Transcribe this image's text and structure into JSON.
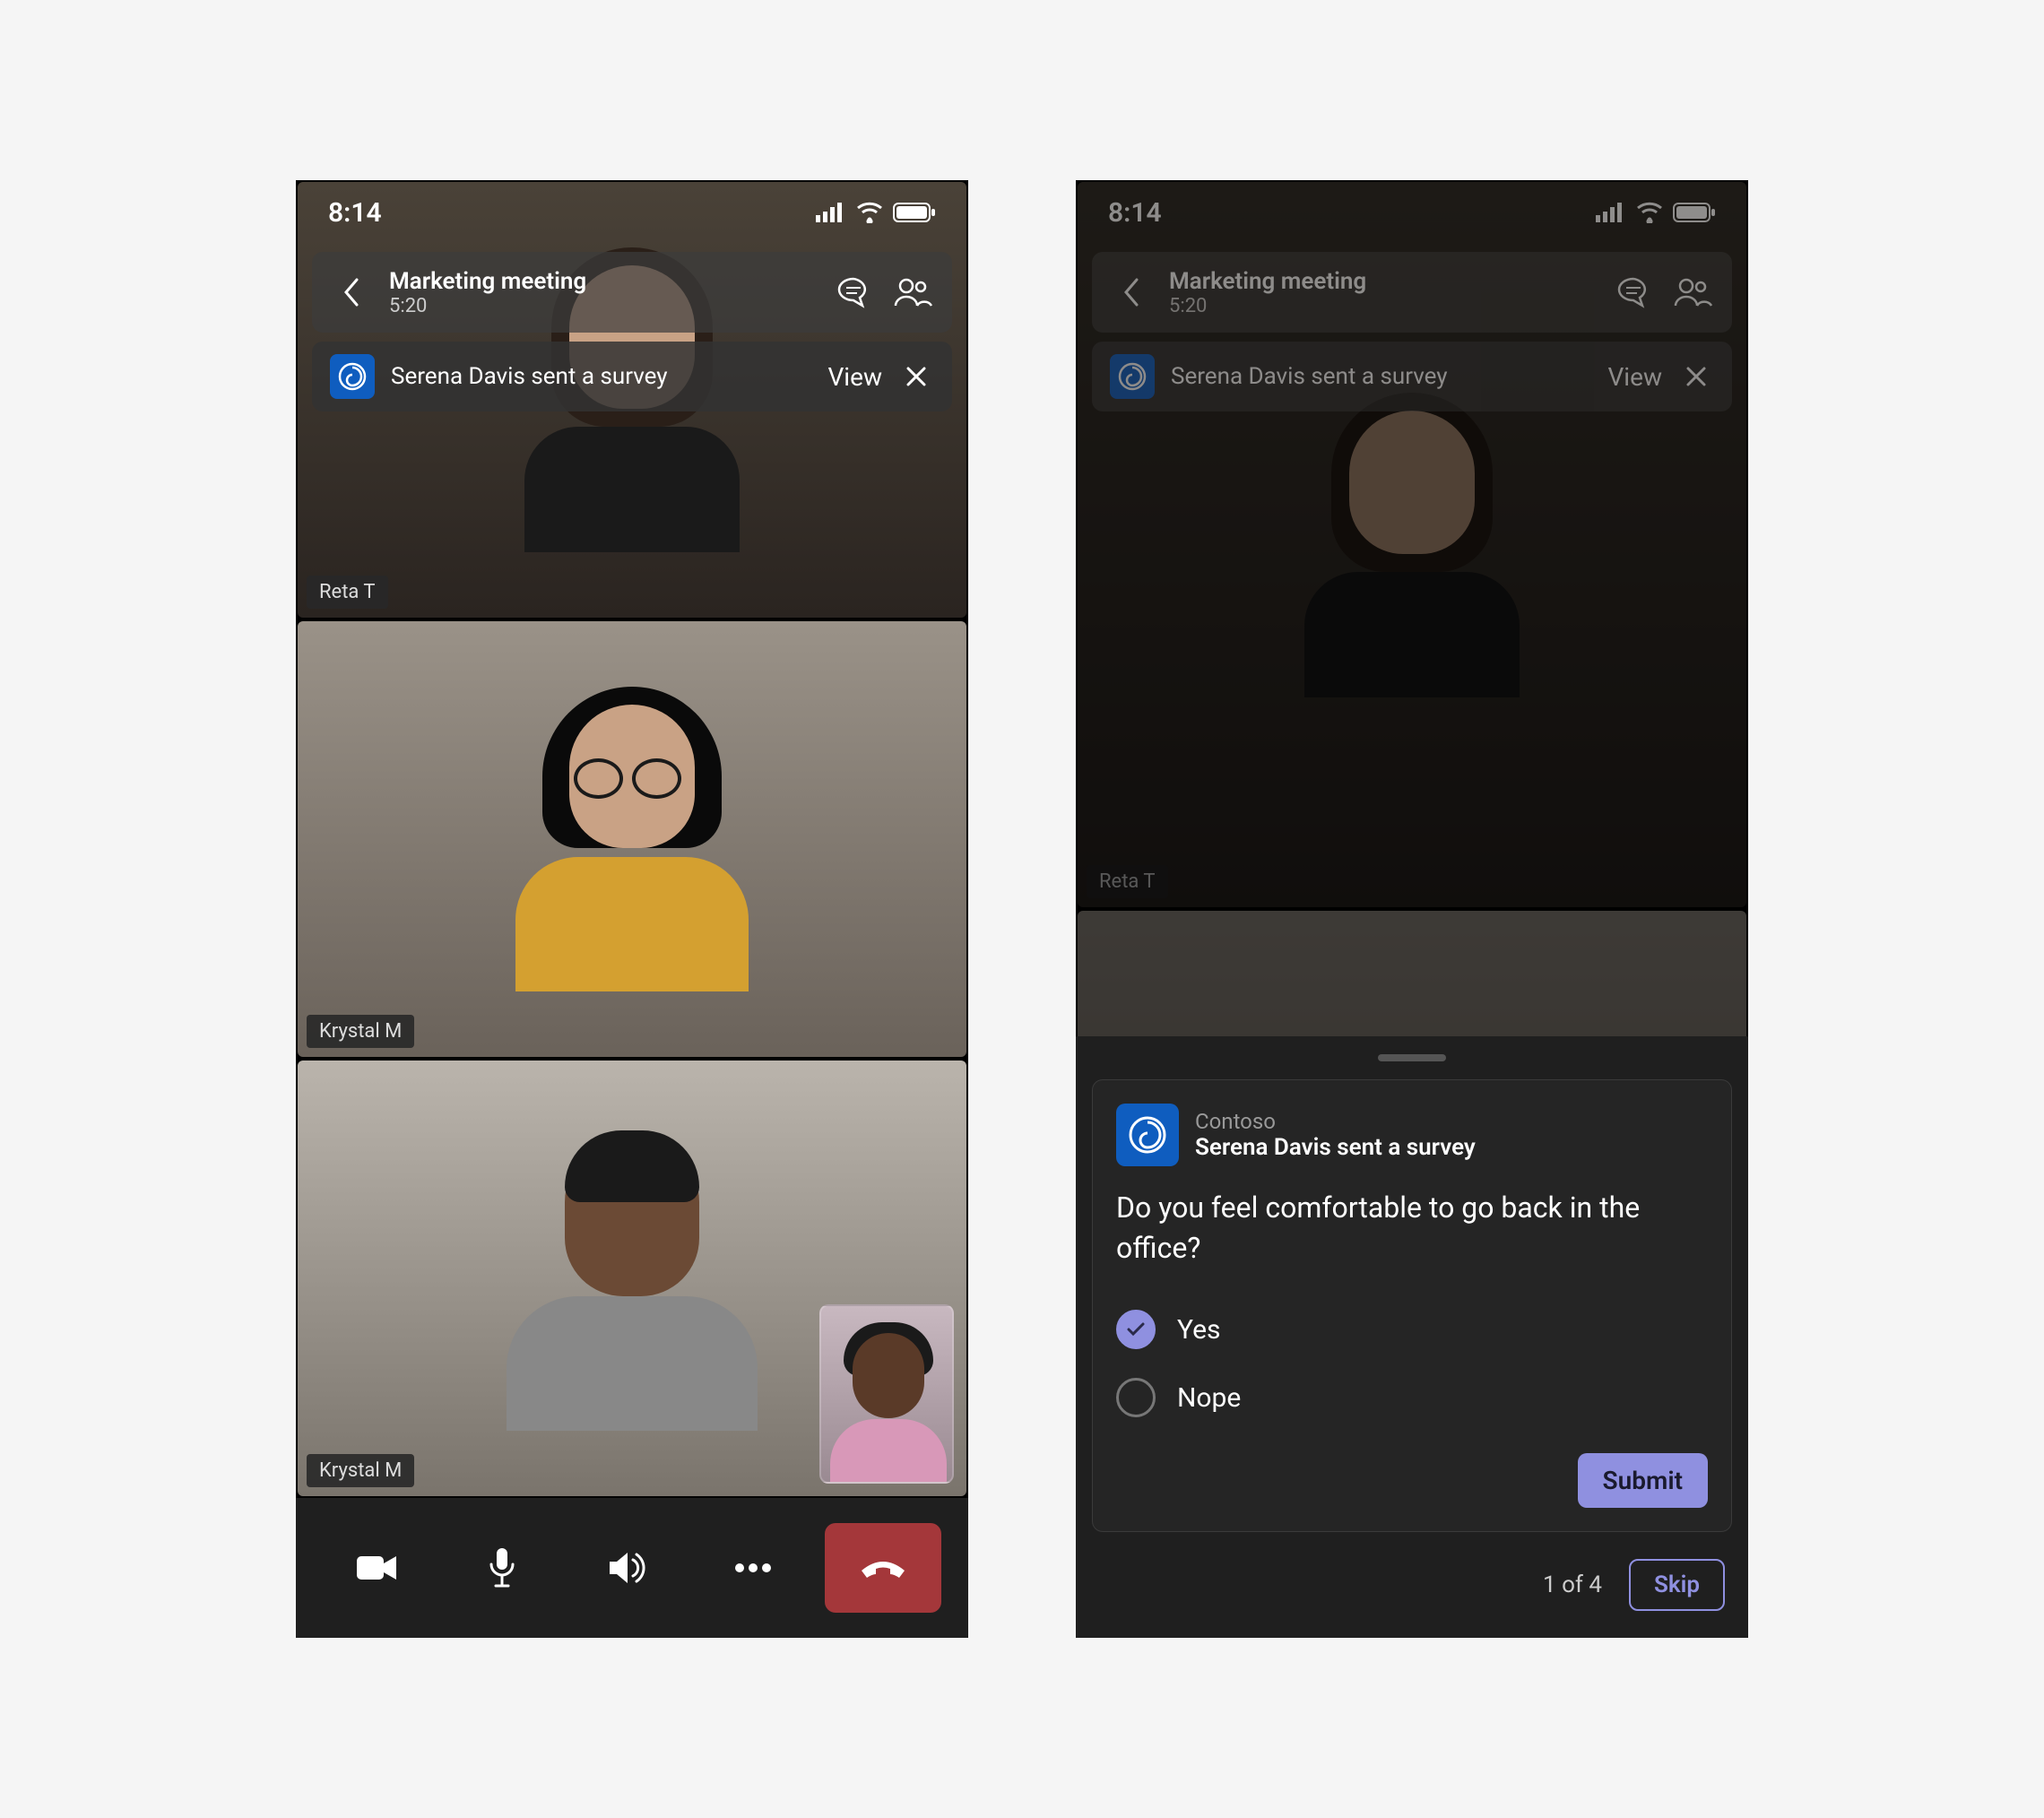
{
  "status": {
    "time": "8:14"
  },
  "header": {
    "title": "Marketing meeting",
    "duration": "5:20"
  },
  "notification": {
    "text": "Serena Davis sent a survey",
    "action": "View"
  },
  "participants": {
    "tile1": "Reta T",
    "tile2": "Krystal M",
    "tile3": "Krystal M"
  },
  "survey": {
    "sender_app": "Contoso",
    "sender_line": "Serena Davis sent a survey",
    "question": "Do you feel comfortable to go back in the office?",
    "option1": "Yes",
    "option2": "Nope",
    "submit": "Submit",
    "page": "1 of 4",
    "skip": "Skip"
  }
}
